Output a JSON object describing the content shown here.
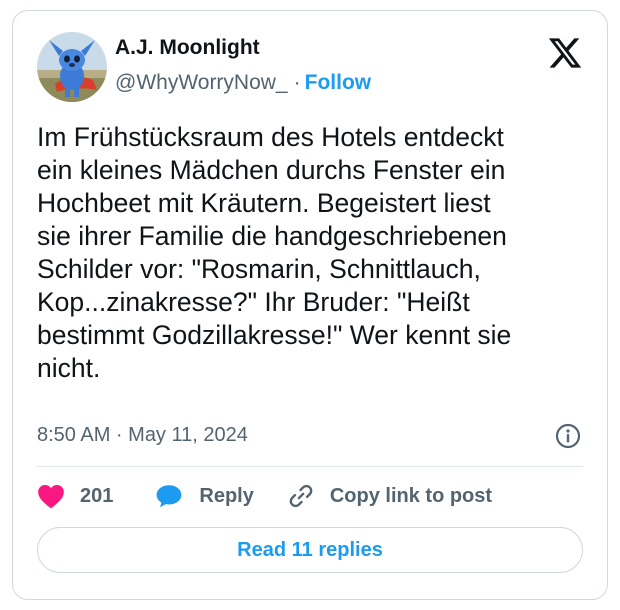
{
  "author": {
    "name": "A.J. Moonlight",
    "handle": "@WhyWorryNow_",
    "separator": "·",
    "follow_label": "Follow"
  },
  "tweet": {
    "text": "Im Frühstücksraum des Hotels entdeckt\nein kleines Mädchen durchs Fenster ein\nHochbeet mit Kräutern. Begeistert liest\nsie ihrer Familie die handgeschriebenen\nSchilder vor: \"Rosmarin, Schnittlauch,\nKop...zinakresse?\" Ihr Bruder: \"Heißt\nbestimmt Godzillakresse!\" Wer kennt sie\nnicht.",
    "timestamp": "8:50 AM · May 11, 2024"
  },
  "actions": {
    "like_count": "201",
    "reply_label": "Reply",
    "copy_link_label": "Copy link to post"
  },
  "read_replies_label": "Read 11 replies",
  "icons": {
    "platform_logo": "x-logo-icon",
    "info": "info-icon",
    "like": "heart-icon",
    "reply": "speech-bubble-icon",
    "copy_link": "link-icon"
  },
  "colors": {
    "accent": "#1d9bf0",
    "like": "#f91880",
    "text_primary": "#0f1419",
    "text_secondary": "#536471",
    "border": "#cfd9de"
  }
}
